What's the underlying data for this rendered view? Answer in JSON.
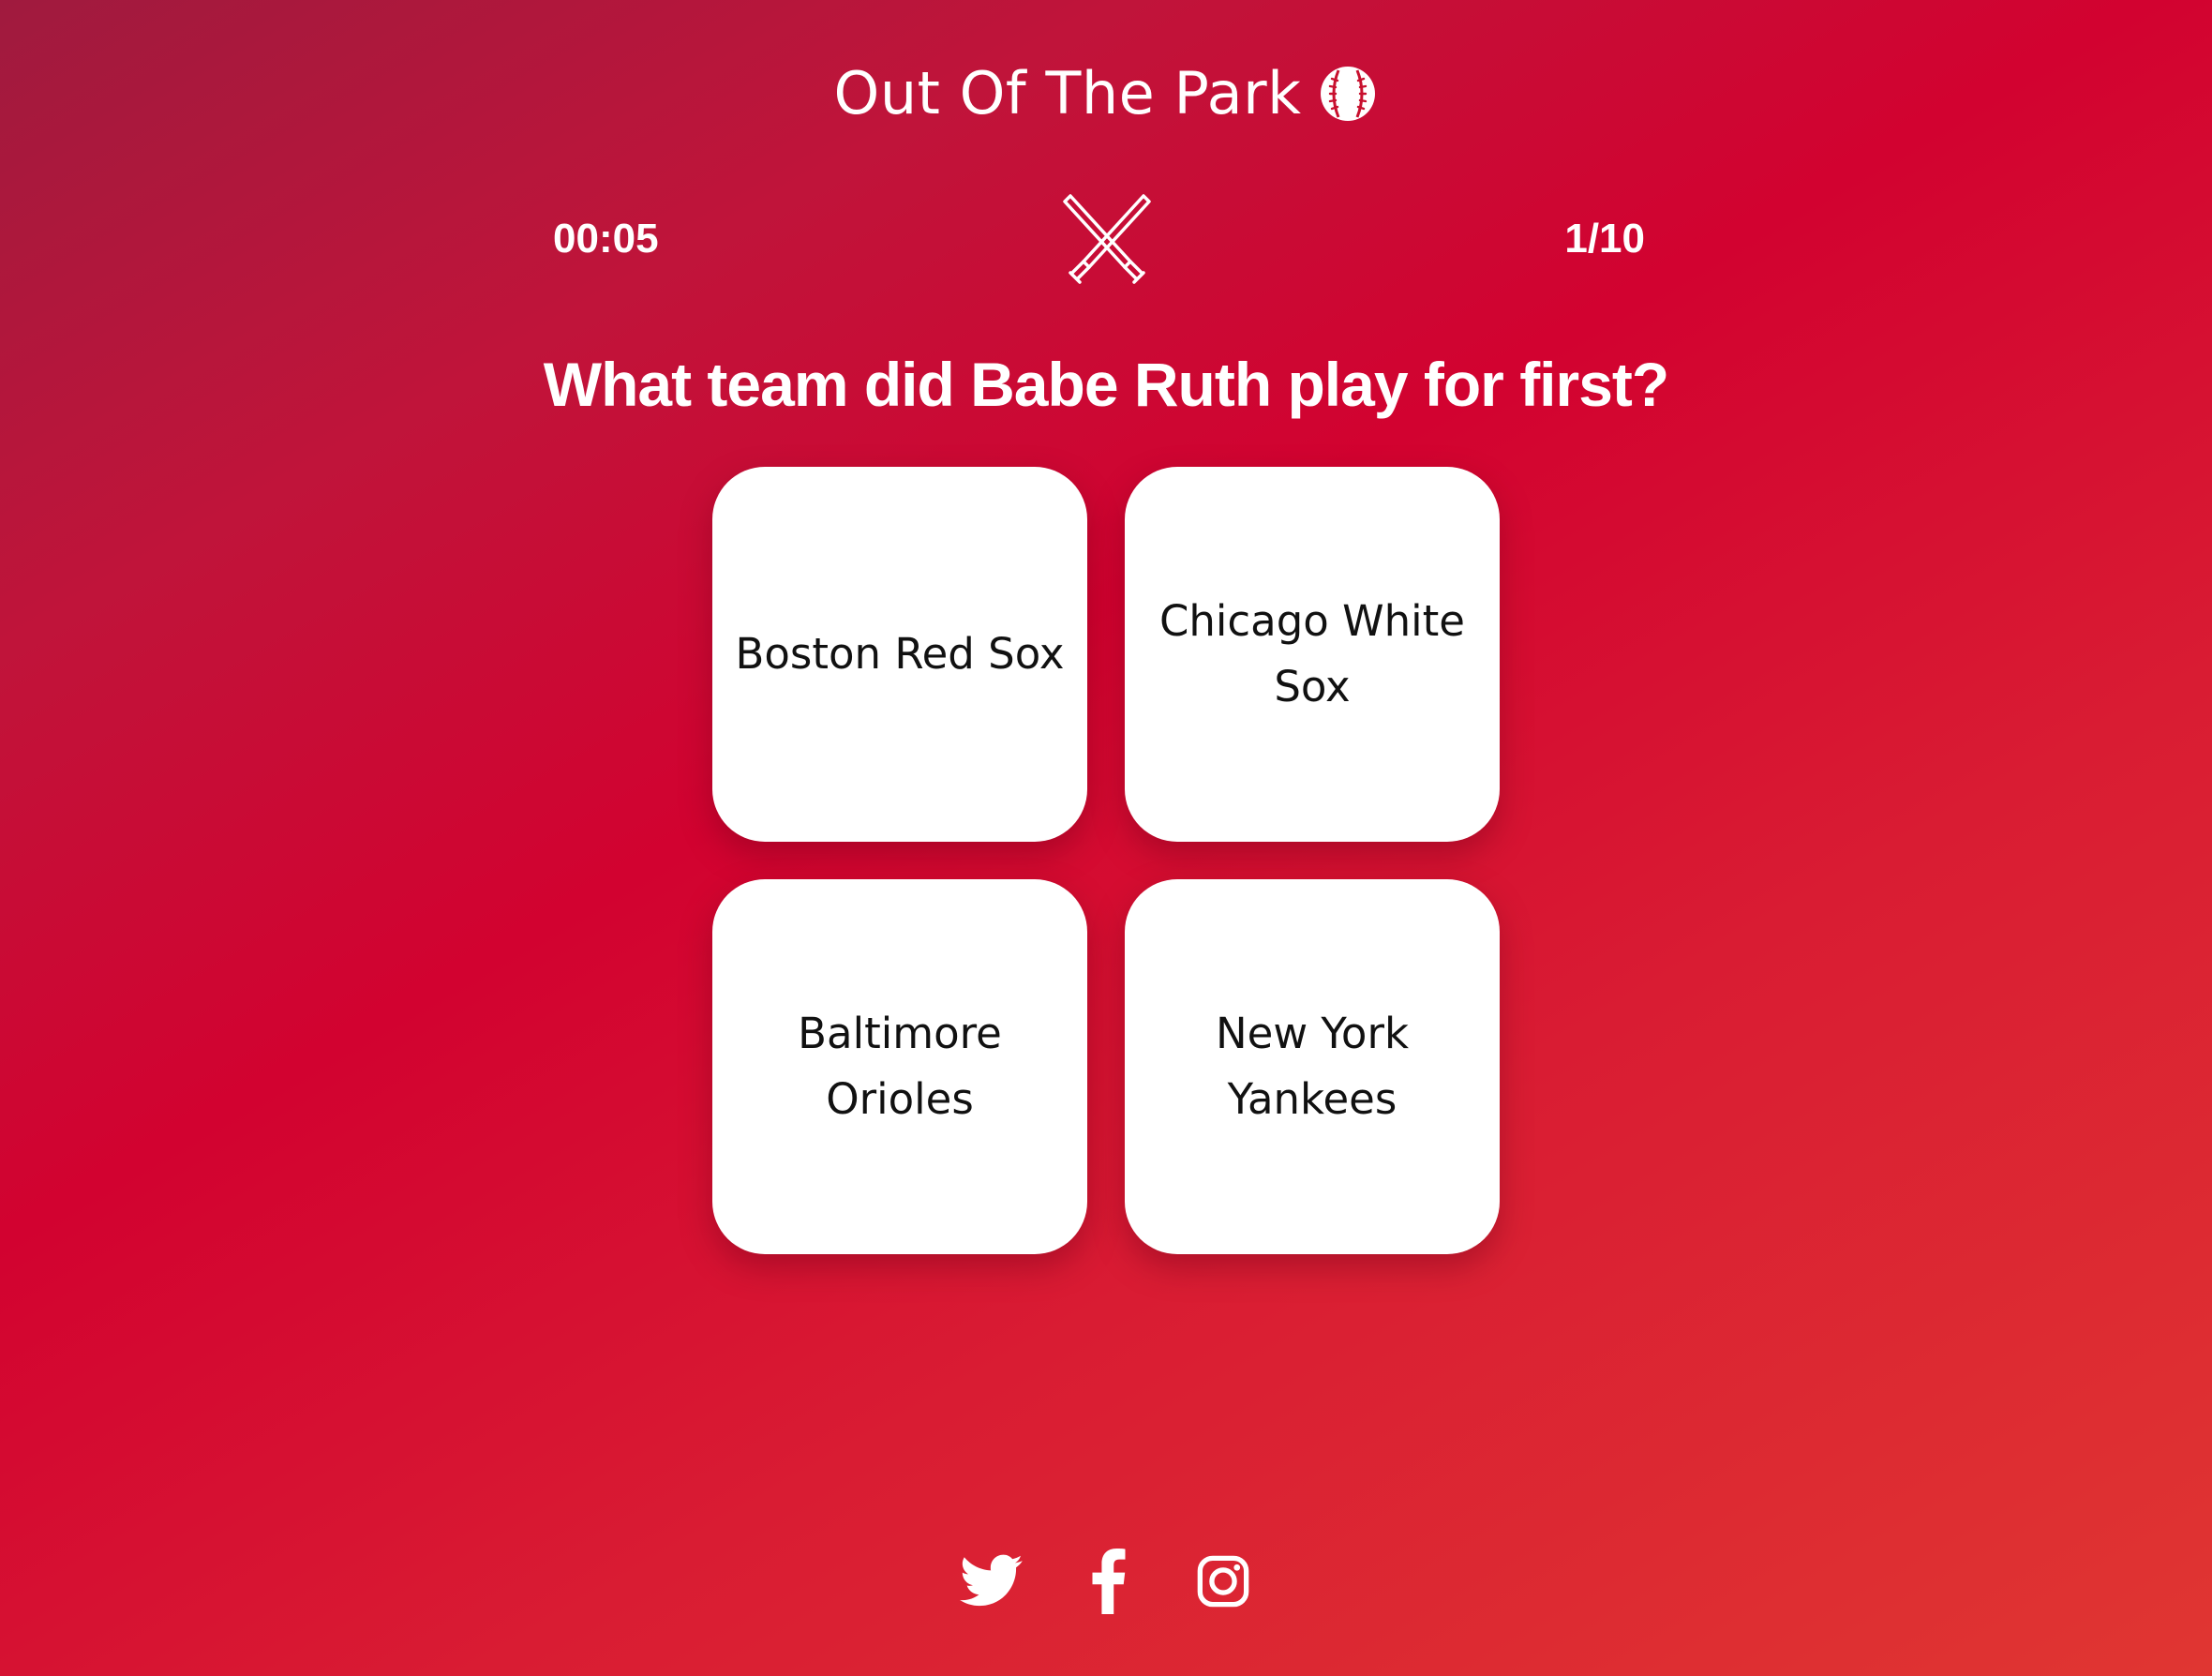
{
  "header": {
    "title": "Out Of The Park",
    "logo_icon": "baseball-icon"
  },
  "status": {
    "timer": "00:05",
    "progress": "1/10",
    "center_icon": "crossed-bats-icon"
  },
  "question": {
    "text": "What team did Babe Ruth play for first?"
  },
  "answers": [
    {
      "label": "Boston Red Sox"
    },
    {
      "label": "Chicago White Sox"
    },
    {
      "label": "Baltimore Orioles"
    },
    {
      "label": "New York Yankees"
    }
  ],
  "social": {
    "icons": [
      "twitter-icon",
      "facebook-icon",
      "instagram-icon"
    ]
  },
  "colors": {
    "background_start": "#a01a3e",
    "background_mid": "#d20230",
    "background_end": "#e03632",
    "card": "#ffffff",
    "card_text": "#111111",
    "text": "#ffffff"
  }
}
